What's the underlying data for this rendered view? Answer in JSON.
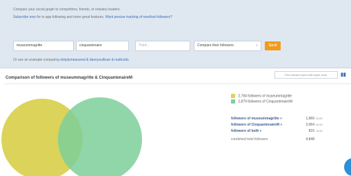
{
  "header": {
    "intro": "Compare your social graph to competitors, friends, or industry leaders.",
    "subscribe_link": "Subscribe now",
    "subscribe_text": "for in-app following and more great features.",
    "tracking_link": "Want precise tracking of new/lost followers?"
  },
  "form": {
    "user1": "museummagritte",
    "user2": "cinquantenaire",
    "third_placeholder": "Third...",
    "compare_select": "Compare their followers",
    "go_label": "Go It"
  },
  "example": {
    "text": "Or see an example comparing",
    "link": "simplymeasured & dannysullivan & mattcutts"
  },
  "section": {
    "title": "Comparison of followers of museummagritte & CinquantenaireM",
    "report_button": "This cached report will expire soon."
  },
  "legend": {
    "items": [
      {
        "label": "2,784 followers of museummagritte",
        "color": "#dcd35a"
      },
      {
        "label": "2,879 followers of CinquantenaireM",
        "color": "#7ecf9a"
      }
    ]
  },
  "stats": {
    "rows": [
      {
        "label": "followers of museummagritte »",
        "value": "1,969",
        "pct": "45.6%"
      },
      {
        "label": "followers of CinquantenaireM »",
        "value": "2,064",
        "pct": "45.9%"
      },
      {
        "label": "followers of both »",
        "value": "815",
        "pct": "18.9%"
      }
    ],
    "combined_label": "combined total followers",
    "combined_value": "4,848"
  },
  "colors": {
    "set1": "#dcd35a",
    "set2": "#7ecf9a",
    "link": "#3b6db3",
    "accent": "#f29b1d"
  },
  "icons": {
    "share": "chart-share-icon",
    "help": "help-bubble-icon"
  }
}
